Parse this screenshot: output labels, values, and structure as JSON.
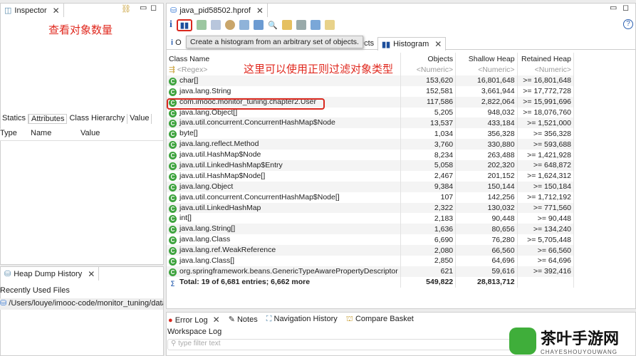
{
  "left": {
    "inspector_tab": "Inspector",
    "annotation": "查看对象数量",
    "tabs": [
      "Statics",
      "Attributes",
      "Class Hierarchy",
      "Value"
    ],
    "columns": [
      "Type",
      "Name",
      "Value"
    ],
    "history_tab": "Heap Dump History",
    "recent_label": "Recently Used Files",
    "recent_file": "/Users/louye/imooc-code/monitor_tuning/data,"
  },
  "editor": {
    "tab": "java_pid58502.hprof",
    "tooltip": "Create a histogram from an arbitrary set of objects.",
    "subtab_left": "O",
    "subtab_mid": "ects",
    "subtab_histogram": "Histogram",
    "annotation": "这里可以使用正则过滤对象类型"
  },
  "histogram": {
    "columns": [
      "Class Name",
      "Objects",
      "Shallow Heap",
      "Retained Heap"
    ],
    "filters": [
      "<Regex>",
      "<Numeric>",
      "<Numeric>",
      "<Numeric>"
    ],
    "rows": [
      [
        "char[]",
        "153,620",
        "16,801,648",
        ">= 16,801,648"
      ],
      [
        "java.lang.String",
        "152,581",
        "3,661,944",
        ">= 17,772,728"
      ],
      [
        "com.imooc.monitor_tuning.chapter2.User",
        "117,586",
        "2,822,064",
        ">= 15,991,696"
      ],
      [
        "java.lang.Object[]",
        "5,205",
        "948,032",
        ">= 18,076,760"
      ],
      [
        "java.util.concurrent.ConcurrentHashMap$Node",
        "13,537",
        "433,184",
        ">= 1,521,000"
      ],
      [
        "byte[]",
        "1,034",
        "356,328",
        ">= 356,328"
      ],
      [
        "java.lang.reflect.Method",
        "3,760",
        "330,880",
        ">= 593,688"
      ],
      [
        "java.util.HashMap$Node",
        "8,234",
        "263,488",
        ">= 1,421,928"
      ],
      [
        "java.util.LinkedHashMap$Entry",
        "5,058",
        "202,320",
        ">= 648,872"
      ],
      [
        "java.util.HashMap$Node[]",
        "2,467",
        "201,152",
        ">= 1,624,312"
      ],
      [
        "java.lang.Object",
        "9,384",
        "150,144",
        ">= 150,184"
      ],
      [
        "java.util.concurrent.ConcurrentHashMap$Node[]",
        "107",
        "142,256",
        ">= 1,712,192"
      ],
      [
        "java.util.LinkedHashMap",
        "2,322",
        "130,032",
        ">= 771,560"
      ],
      [
        "int[]",
        "2,183",
        "90,448",
        ">= 90,448"
      ],
      [
        "java.lang.String[]",
        "1,636",
        "80,656",
        ">= 134,240"
      ],
      [
        "java.lang.Class",
        "6,690",
        "76,280",
        ">= 5,705,448"
      ],
      [
        "java.lang.ref.WeakReference",
        "2,080",
        "66,560",
        ">= 66,560"
      ],
      [
        "java.lang.Class[]",
        "2,850",
        "64,696",
        ">= 64,696"
      ],
      [
        "org.springframework.beans.GenericTypeAwarePropertyDescriptor",
        "621",
        "59,616",
        ">= 392,416"
      ]
    ],
    "total": [
      "Total: 19 of 6,681 entries; 6,662 more",
      "549,822",
      "28,813,712",
      ""
    ]
  },
  "bottom": {
    "tabs": [
      "Error Log",
      "Notes",
      "Navigation History",
      "Compare Basket"
    ],
    "workspace_log": "Workspace Log",
    "filter_placeholder": "type filter text"
  },
  "watermark": {
    "title": "茶叶手游网",
    "subtitle": "CHAYESHOUYOUWANG"
  },
  "colors": {
    "accent_red": "#e0281e",
    "class_icon": "#3ea33e"
  }
}
